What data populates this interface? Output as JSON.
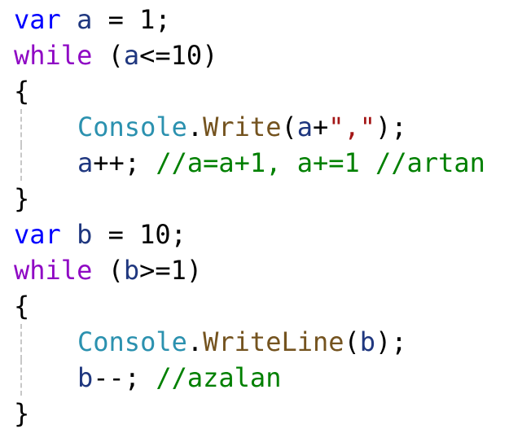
{
  "colors": {
    "keyword": "#0000ff",
    "control": "#8f08c4",
    "variable": "#1f377f",
    "type": "#2b91af",
    "method": "#74531f",
    "string": "#a31515",
    "comment": "#008000",
    "plain": "#000000",
    "guide": "#c8c8c8"
  },
  "code": {
    "lines": [
      {
        "indent": 0,
        "tokens": [
          {
            "text": "var",
            "kind": "keyword"
          },
          {
            "text": " ",
            "kind": "plain"
          },
          {
            "text": "a",
            "kind": "variable"
          },
          {
            "text": " = 1;",
            "kind": "plain"
          }
        ]
      },
      {
        "indent": 0,
        "tokens": [
          {
            "text": "while",
            "kind": "control"
          },
          {
            "text": " (",
            "kind": "plain"
          },
          {
            "text": "a",
            "kind": "variable"
          },
          {
            "text": "<=10)",
            "kind": "plain"
          }
        ]
      },
      {
        "indent": 0,
        "tokens": [
          {
            "text": "{",
            "kind": "plain"
          }
        ]
      },
      {
        "indent": 1,
        "tokens": [
          {
            "text": "Console",
            "kind": "type"
          },
          {
            "text": ".",
            "kind": "plain"
          },
          {
            "text": "Write",
            "kind": "method"
          },
          {
            "text": "(",
            "kind": "plain"
          },
          {
            "text": "a",
            "kind": "variable"
          },
          {
            "text": "+",
            "kind": "plain"
          },
          {
            "text": "\",\"",
            "kind": "string"
          },
          {
            "text": ");",
            "kind": "plain"
          }
        ]
      },
      {
        "indent": 1,
        "tokens": [
          {
            "text": "a",
            "kind": "variable"
          },
          {
            "text": "++; ",
            "kind": "plain"
          },
          {
            "text": "//a=a+1, a+=1 //artan",
            "kind": "comment"
          }
        ]
      },
      {
        "indent": 0,
        "tokens": [
          {
            "text": "}",
            "kind": "plain"
          }
        ]
      },
      {
        "indent": 0,
        "tokens": [
          {
            "text": "var",
            "kind": "keyword"
          },
          {
            "text": " ",
            "kind": "plain"
          },
          {
            "text": "b",
            "kind": "variable"
          },
          {
            "text": " = 10;",
            "kind": "plain"
          }
        ]
      },
      {
        "indent": 0,
        "tokens": [
          {
            "text": "while",
            "kind": "control"
          },
          {
            "text": " (",
            "kind": "plain"
          },
          {
            "text": "b",
            "kind": "variable"
          },
          {
            "text": ">=1)",
            "kind": "plain"
          }
        ]
      },
      {
        "indent": 0,
        "tokens": [
          {
            "text": "{",
            "kind": "plain"
          }
        ]
      },
      {
        "indent": 1,
        "tokens": [
          {
            "text": "Console",
            "kind": "type"
          },
          {
            "text": ".",
            "kind": "plain"
          },
          {
            "text": "WriteLine",
            "kind": "method"
          },
          {
            "text": "(",
            "kind": "plain"
          },
          {
            "text": "b",
            "kind": "variable"
          },
          {
            "text": ");",
            "kind": "plain"
          }
        ]
      },
      {
        "indent": 1,
        "tokens": [
          {
            "text": "b",
            "kind": "variable"
          },
          {
            "text": "--; ",
            "kind": "plain"
          },
          {
            "text": "//azalan",
            "kind": "comment"
          }
        ]
      },
      {
        "indent": 0,
        "tokens": [
          {
            "text": "}",
            "kind": "plain"
          }
        ]
      }
    ]
  }
}
